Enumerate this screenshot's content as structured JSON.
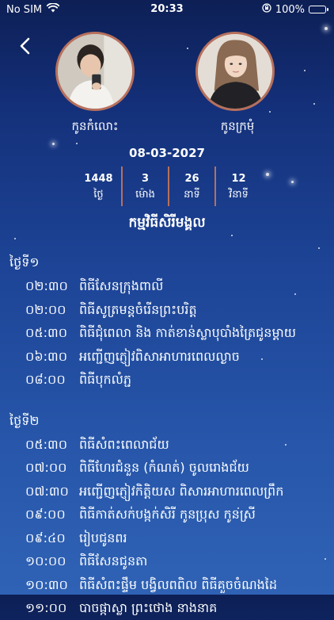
{
  "status_bar": {
    "carrier": "No SIM",
    "time": "20:33",
    "battery": "100%",
    "icons": [
      "wifi-icon",
      "lock-rotation-icon",
      "battery-icon"
    ]
  },
  "nav": {
    "back_icon": "chevron-left-icon"
  },
  "couple": {
    "groom": {
      "name": "កូនកំលោះ"
    },
    "bride": {
      "name": "កូនក្រមុំ"
    }
  },
  "wedding_date": "08-03-2027",
  "countdown": [
    {
      "value": "1448",
      "unit": "ថ្ងៃ"
    },
    {
      "value": "3",
      "unit": "ម៉ោង"
    },
    {
      "value": "26",
      "unit": "នាទី"
    },
    {
      "value": "12",
      "unit": "វិនាទី"
    }
  ],
  "program_title": "កម្មវិធីសិរីមង្គល",
  "schedule": [
    {
      "day": "ថ្ងៃទី១",
      "events": [
        {
          "time": "០២:៣០",
          "title": "ពិធីសែនក្រុងពាលី"
        },
        {
          "time": "០២:០០",
          "title": "ពិធីសូត្រមន្តចំរើនព្រះបរិត្ត"
        },
        {
          "time": "០៥:៣០",
          "title": "ពិធីជុំពេលា និង កាត់ខាន់ស្លាបុបាំងត្រៃជូនម្ដាយ"
        },
        {
          "time": "០៦:៣០",
          "title": "អញ្ជើញភ្ញៀវពិសាអាហារពេលល្ងាច"
        },
        {
          "time": "០៨:០០",
          "title": "ពិធីបុកលំភ្ជ"
        }
      ]
    },
    {
      "day": "ថ្ងៃទី២",
      "events": [
        {
          "time": "០៥:៣០",
          "title": "ពិធីសំពះពេលាជ័យ"
        },
        {
          "time": "០៧:០០",
          "title": "ពិធីហែរជំនួន (កំណត់) ចូលរោងជ័យ"
        },
        {
          "time": "០៧:៣០",
          "title": "អញ្ជើញភ្ញៀវកិត្តិយស ពិសារអាហារពេលព្រឹក"
        },
        {
          "time": "០៩:០០",
          "title": "ពិធីកាត់សក់បង្កក់សិរី កូនប្រុស កូនស្រី"
        },
        {
          "time": "០៩:៤០",
          "title": "រៀបជូនពរ"
        },
        {
          "time": "១០:០០",
          "title": "ពិធីសែនជូនតា"
        },
        {
          "time": "១០:៣០",
          "title": "ពិធីសំពះផ្ទឹម បង្វិលពពិល ពិធីគួចចំណងដៃ"
        },
        {
          "time": "១១:០០",
          "title": "បាចផ្កាស្លា ព្រះថោង នាងនាគ"
        }
      ]
    }
  ],
  "colors": {
    "accent_border": "#b8705c",
    "background_top": "#0d1f55",
    "background_bottom": "#2f62b5"
  }
}
